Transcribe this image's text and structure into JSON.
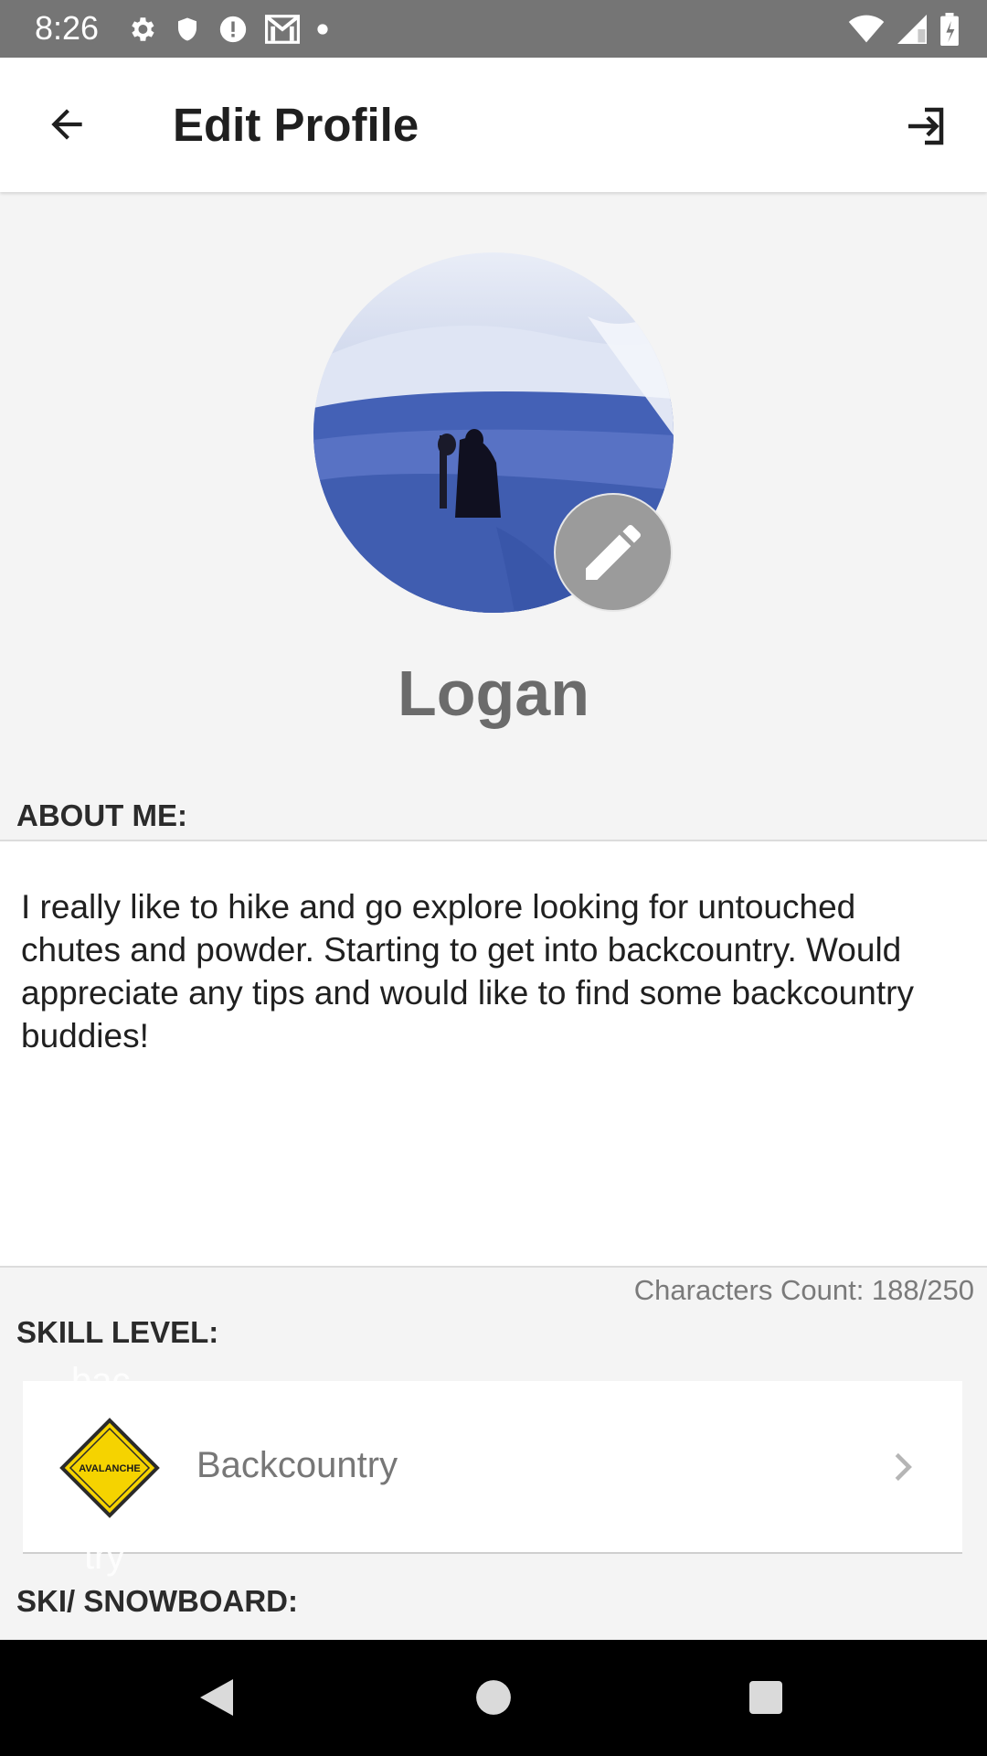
{
  "status_bar": {
    "time": "8:26",
    "left_icons": [
      "settings-icon",
      "shield-icon",
      "alert-icon",
      "gmail-icon",
      "dot-icon"
    ],
    "right_icons": [
      "wifi-icon",
      "signal-icon",
      "battery-icon"
    ]
  },
  "app_bar": {
    "title": "Edit Profile",
    "back_icon": "arrow-back-icon",
    "logout_icon": "logout-icon"
  },
  "profile": {
    "name": "Logan",
    "edit_icon": "pencil-icon"
  },
  "about": {
    "label": "ABOUT ME:",
    "text": "I really like to hike and go explore looking for untouched chutes and powder.  Starting to get into backcountry. Would appreciate any tips and would like to find some backcountry buddies!",
    "char_count": "Characters Count: 188/250"
  },
  "skill": {
    "label": "SKILL LEVEL:",
    "badge_text": "AVALANCHE",
    "value": "Backcountry",
    "ghost_top": "bac",
    "ghost_bottom": "try"
  },
  "ski": {
    "label": "SKI/ SNOWBOARD:"
  },
  "colors": {
    "status_bar": "#757575",
    "app_bar": "#ffffff",
    "background": "#f4f4f4",
    "badge_yellow": "#f5d300",
    "edit_button": "#9b9b9b"
  }
}
